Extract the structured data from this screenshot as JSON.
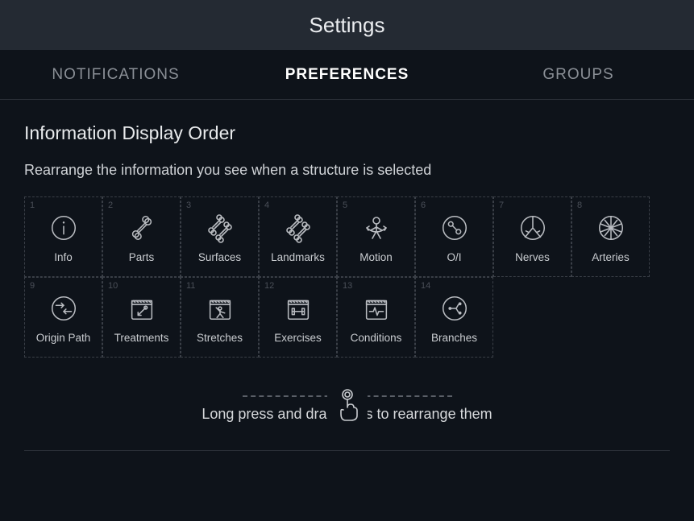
{
  "header": {
    "title": "Settings"
  },
  "tabs": {
    "notifications": "NOTIFICATIONS",
    "preferences": "PREFERENCES",
    "groups": "GROUPS"
  },
  "section": {
    "title": "Information Display Order",
    "subtitle": "Rearrange the information you see when a structure is selected"
  },
  "tiles": [
    {
      "num": "1",
      "label": "Info",
      "icon": "info"
    },
    {
      "num": "2",
      "label": "Parts",
      "icon": "bone-single"
    },
    {
      "num": "3",
      "label": "Surfaces",
      "icon": "bone-double"
    },
    {
      "num": "4",
      "label": "Landmarks",
      "icon": "bone-double"
    },
    {
      "num": "5",
      "label": "Motion",
      "icon": "motion"
    },
    {
      "num": "6",
      "label": "O/I",
      "icon": "oi"
    },
    {
      "num": "7",
      "label": "Nerves",
      "icon": "nerves"
    },
    {
      "num": "8",
      "label": "Arteries",
      "icon": "arteries"
    },
    {
      "num": "9",
      "label": "Origin Path",
      "icon": "origin-path"
    },
    {
      "num": "10",
      "label": "Treatments",
      "icon": "treatments"
    },
    {
      "num": "11",
      "label": "Stretches",
      "icon": "stretches"
    },
    {
      "num": "12",
      "label": "Exercises",
      "icon": "exercises"
    },
    {
      "num": "13",
      "label": "Conditions",
      "icon": "conditions"
    },
    {
      "num": "14",
      "label": "Branches",
      "icon": "branches"
    }
  ],
  "hint": "Long press and drag icons to rearrange them"
}
